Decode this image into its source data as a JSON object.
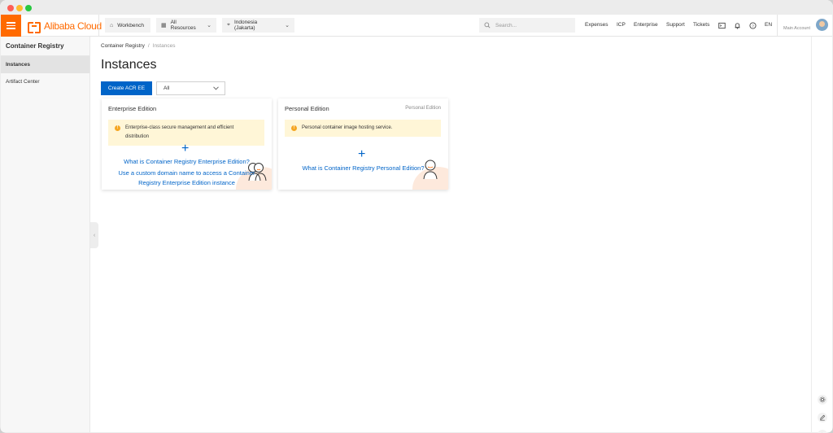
{
  "brand": {
    "name": "Alibaba Cloud",
    "accent": "#ff6a00",
    "primary": "#0064c8"
  },
  "topbar": {
    "workbench": "Workbench",
    "resources": "All Resources",
    "region": "Indonesia (Jakarta)",
    "search_placeholder": "Search...",
    "links": [
      "Expenses",
      "ICP",
      "Enterprise",
      "Support",
      "Tickets"
    ],
    "language": "EN",
    "account": "Main Account"
  },
  "sidebar": {
    "title": "Container Registry",
    "items": [
      {
        "label": "Instances",
        "active": true
      },
      {
        "label": "Artifact Center",
        "active": false
      }
    ]
  },
  "breadcrumb": {
    "parent": "Container Registry",
    "separator": "/",
    "current": "Instances"
  },
  "page": {
    "title": "Instances",
    "create_button": "Create ACR EE",
    "filter_value": "All"
  },
  "cards": [
    {
      "title": "Enterprise Edition",
      "tag": "",
      "notice": "Enterprise-class secure management and efficient distribution",
      "links": [
        "What is Container Registry Enterprise Edition?",
        "Use a custom domain name to access a Container Registry Enterprise Edition instance"
      ]
    },
    {
      "title": "Personal Edition",
      "tag": "Personal Edition",
      "notice": "Personal container image hosting service.",
      "links": [
        "What is Container Registry Personal Edition?"
      ]
    }
  ],
  "icons": {
    "menu": "hamburger-icon",
    "workbench": "home-icon",
    "resources": "grid-icon",
    "region": "location-icon",
    "search": "search-icon",
    "terminal": "terminal-icon",
    "notifications": "bell-icon",
    "help": "help-icon",
    "right_tools": [
      "settings-icon",
      "edit-icon",
      "expand-icon"
    ]
  }
}
